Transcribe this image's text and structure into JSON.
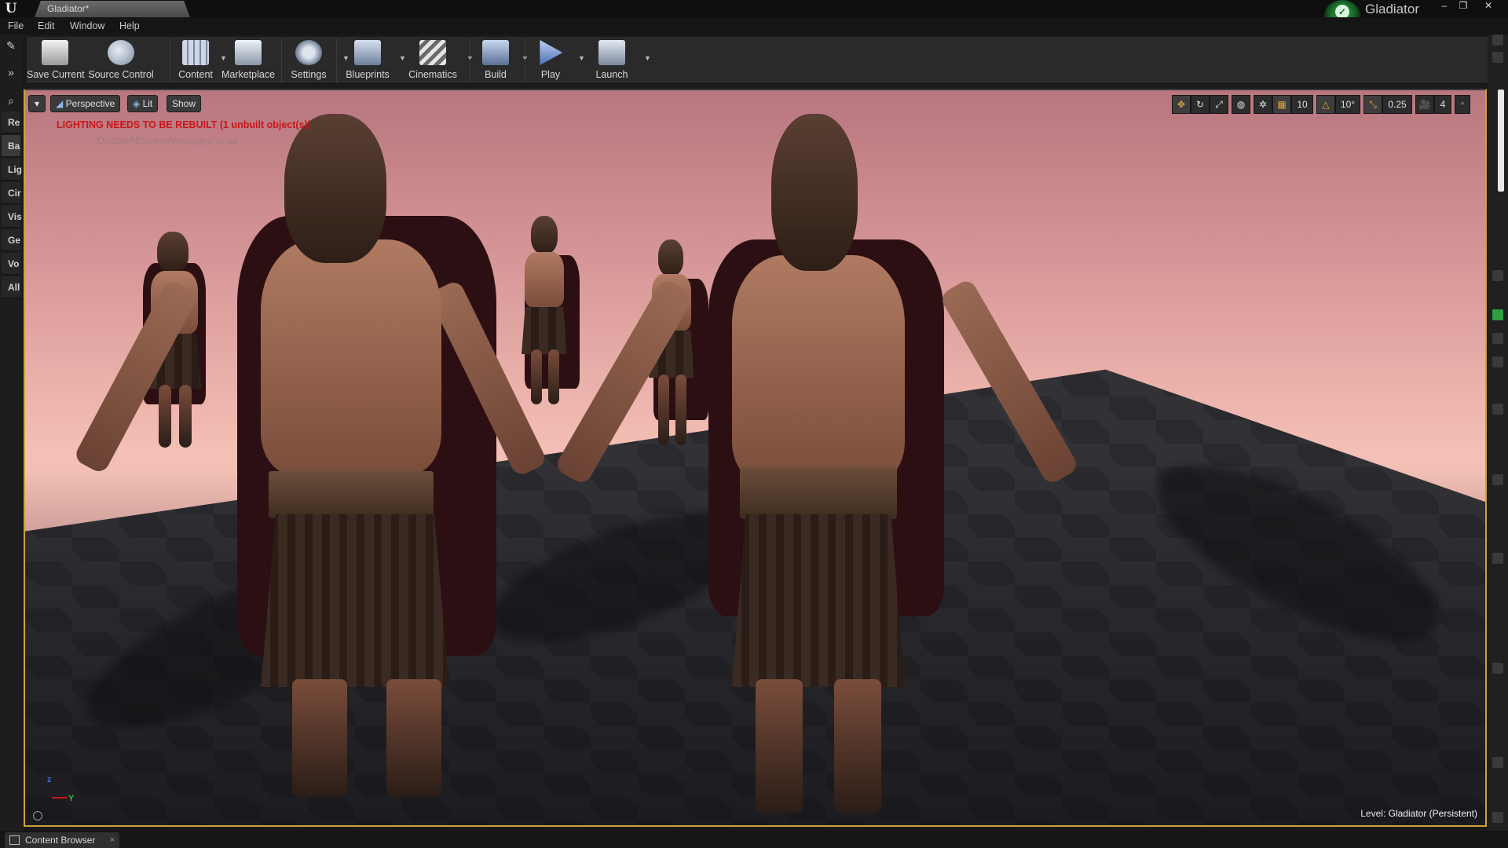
{
  "window": {
    "document_tab": "Gladiator*",
    "project_name": "Gladiator",
    "controls": [
      "–",
      "❐",
      "✕"
    ]
  },
  "menu": [
    "File",
    "Edit",
    "Window",
    "Help"
  ],
  "left_strip": {
    "tabs": [
      "Re",
      "Ba",
      "Lig",
      "Cir",
      "Vis",
      "Ge",
      "Vo",
      "All"
    ]
  },
  "toolbar": {
    "save_current": "Save Current",
    "source_control": "Source Control",
    "content": "Content",
    "marketplace": "Marketplace",
    "settings": "Settings",
    "blueprints": "Blueprints",
    "cinematics": "Cinematics",
    "build": "Build",
    "play": "Play",
    "launch": "Launch"
  },
  "viewport": {
    "view_mode": "Perspective",
    "lighting_mode": "Lit",
    "show_label": "Show",
    "warning": "LIGHTING NEEDS TO BE REBUILT (1 unbuilt object(s))",
    "hint": "'DisableAllScreenMessages' to su",
    "grid_snap": "10",
    "rotation_snap": "10°",
    "scale_snap": "0.25",
    "camera_speed": "4",
    "level_label": "Level:",
    "level_name": "Gladiator (Persistent)",
    "axis_z": "z",
    "axis_y": "Y"
  },
  "bottom": {
    "content_browser": "Content Browser",
    "close": "×"
  },
  "colors": {
    "accent_border": "#caa33a",
    "warning_red": "#c9161a",
    "project_green": "#2ea043"
  }
}
